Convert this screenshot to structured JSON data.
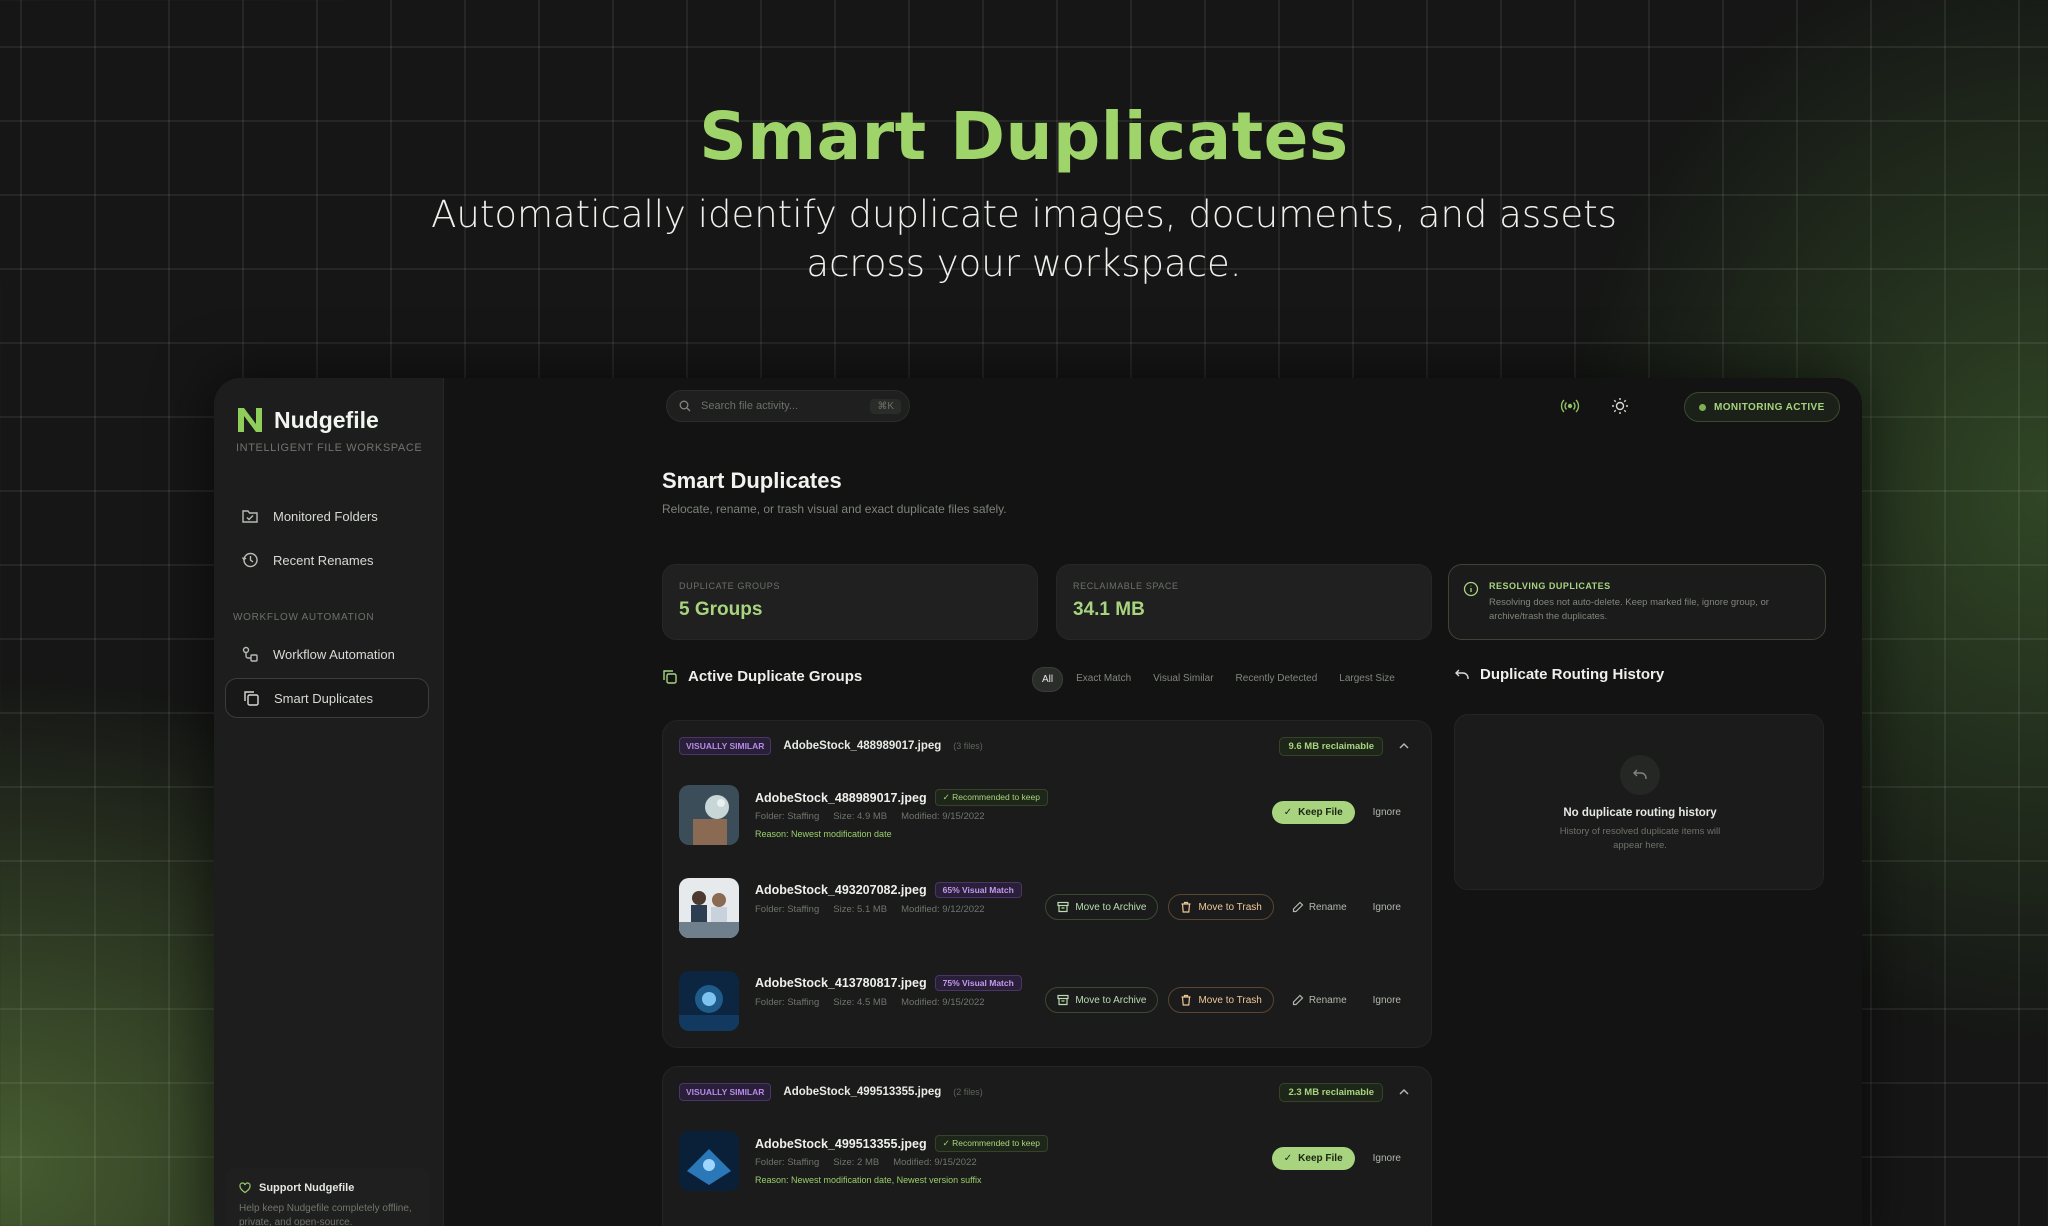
{
  "hero": {
    "title": "Smart Duplicates",
    "subtitle": "Automatically identify duplicate images, documents, and assets across your workspace."
  },
  "colors": {
    "accent": "#a8d47f",
    "purple": "#b68ae8",
    "background": "#121312"
  },
  "sidebar": {
    "brand": "Nudgefile",
    "tagline": "INTELLIGENT FILE WORKSPACE",
    "items": [
      {
        "label": "Monitored Folders",
        "icon": "folder-check-icon"
      },
      {
        "label": "Recent Renames",
        "icon": "history-icon"
      }
    ],
    "section_label": "WORKFLOW AUTOMATION",
    "automation_items": [
      {
        "label": "Workflow Automation",
        "icon": "workflow-icon"
      },
      {
        "label": "Smart Duplicates",
        "icon": "duplicate-icon",
        "active": true
      }
    ],
    "support": {
      "title": "Support Nudgefile",
      "text": "Help keep Nudgefile completely offline, private, and open-source."
    }
  },
  "topbar": {
    "search_placeholder": "Search file activity...",
    "shortcut": "⌘K",
    "status": "MONITORING ACTIVE"
  },
  "main": {
    "title": "Smart Duplicates",
    "subtitle": "Relocate, rename, or trash visual and exact duplicate files safely.",
    "stats": [
      {
        "label": "DUPLICATE GROUPS",
        "value": "5 Groups"
      },
      {
        "label": "RECLAIMABLE SPACE",
        "value": "34.1 MB"
      }
    ],
    "resolve": {
      "title": "RESOLVING DUPLICATES",
      "text": "Resolving does not auto-delete. Keep marked file, ignore group, or archive/trash the duplicates."
    },
    "groups_heading": "Active Duplicate Groups",
    "filters": [
      "All",
      "Exact Match",
      "Visual Similar",
      "Recently Detected",
      "Largest Size"
    ],
    "history": {
      "heading": "Duplicate Routing History",
      "empty_title": "No duplicate routing history",
      "empty_text": "History of resolved duplicate items will appear here."
    },
    "labels": {
      "keep": "Keep File",
      "ignore": "Ignore",
      "archive": "Move to Archive",
      "trash": "Move to Trash",
      "rename": "Rename",
      "recommended": "Recommended to keep"
    },
    "groups": [
      {
        "tag": "VISUALLY SIMILAR",
        "name": "AdobeStock_488989017.jpeg",
        "count": "(3 files)",
        "reclaim": "9.6 MB reclaimable",
        "files": [
          {
            "name": "AdobeStock_488989017.jpeg",
            "folder": "Folder: Staffing",
            "size": "Size: 4.9 MB",
            "modified": "Modified: 9/15/2022",
            "reason": "Reason: Newest modification date"
          },
          {
            "name": "AdobeStock_493207082.jpeg",
            "match": "65% Visual Match",
            "folder": "Folder: Staffing",
            "size": "Size: 5.1 MB",
            "modified": "Modified: 9/12/2022"
          },
          {
            "name": "AdobeStock_413780817.jpeg",
            "match": "75% Visual Match",
            "folder": "Folder: Staffing",
            "size": "Size: 4.5 MB",
            "modified": "Modified: 9/15/2022"
          }
        ]
      },
      {
        "tag": "VISUALLY SIMILAR",
        "name": "AdobeStock_499513355.jpeg",
        "count": "(2 files)",
        "reclaim": "2.3 MB reclaimable",
        "files": [
          {
            "name": "AdobeStock_499513355.jpeg",
            "folder": "Folder: Staffing",
            "size": "Size: 2 MB",
            "modified": "Modified: 9/15/2022",
            "reason": "Reason: Newest modification date, Newest version suffix"
          }
        ]
      }
    ]
  }
}
